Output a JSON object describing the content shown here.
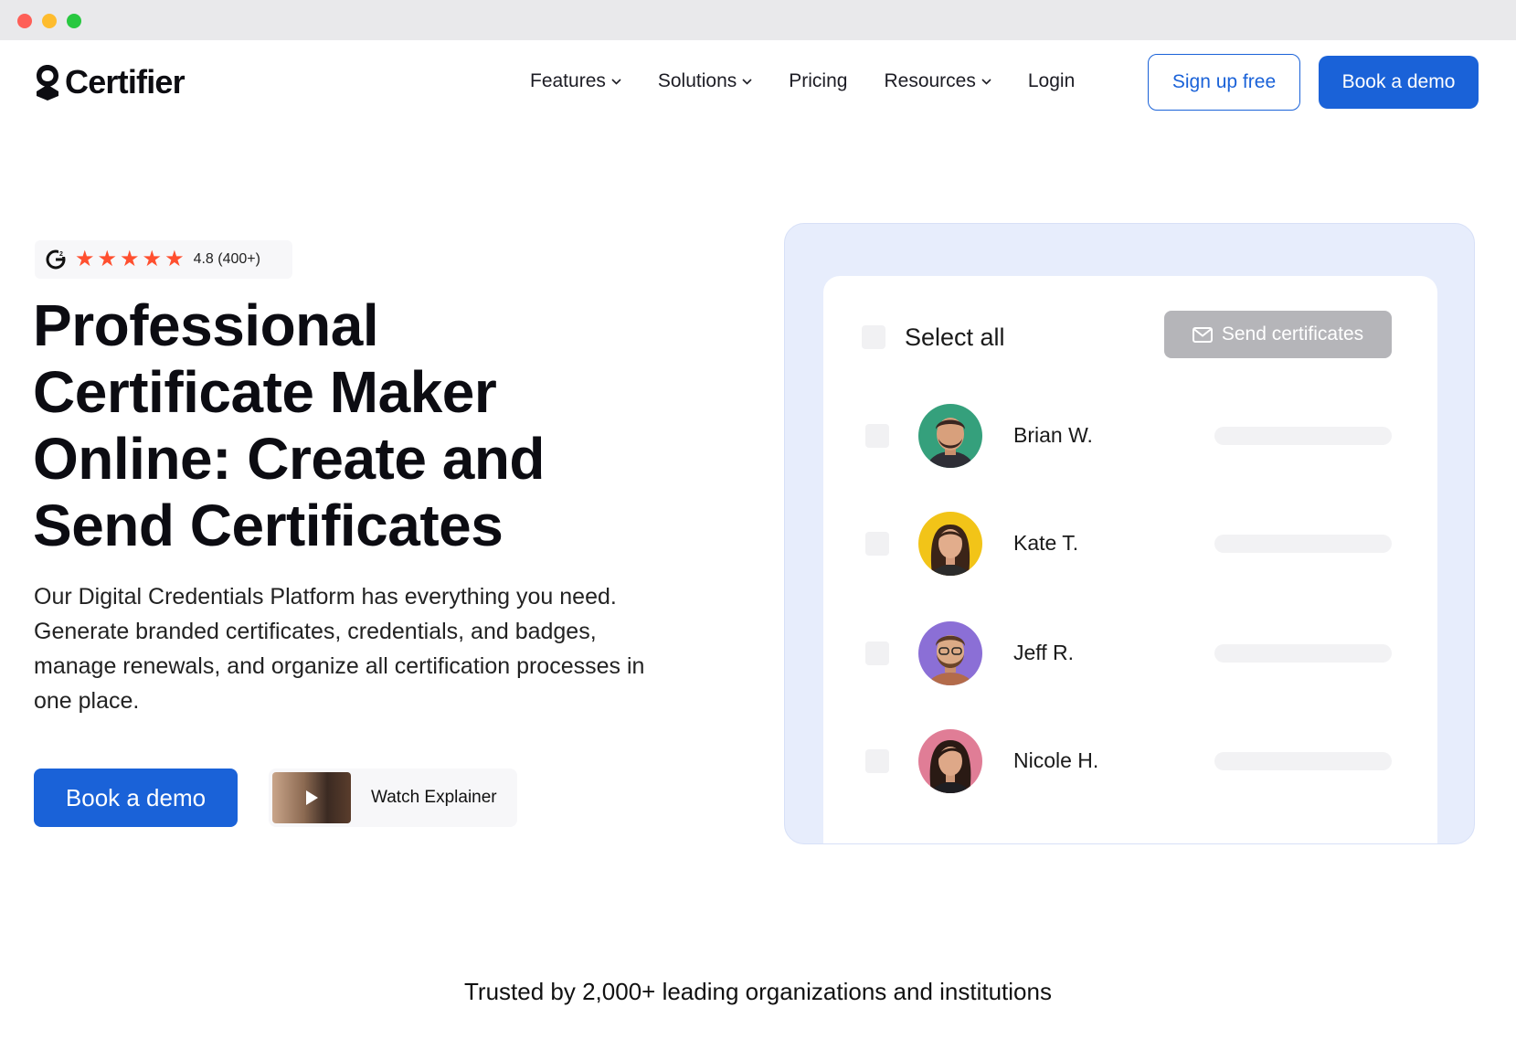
{
  "nav": {
    "brand": "Certifier",
    "items": [
      {
        "label": "Features",
        "dropdown": true
      },
      {
        "label": "Solutions",
        "dropdown": true
      },
      {
        "label": "Pricing",
        "dropdown": false
      },
      {
        "label": "Resources",
        "dropdown": true
      },
      {
        "label": "Login",
        "dropdown": false
      }
    ],
    "signup_label": "Sign up free",
    "demo_label": "Book a demo"
  },
  "rating": {
    "stars": 5,
    "text": "4.8 (400+)",
    "icon": "g2-icon",
    "star_color": "#ff4f2f"
  },
  "hero": {
    "title": "Professional Certificate Maker Online: Create and Send Certificates",
    "description": "Our Digital Credentials Platform has everything you need. Generate branded certificates, credentials, and badges, manage renewals, and organize all certification processes in one place.",
    "cta_label": "Book a demo",
    "watch_label": "Watch Explainer"
  },
  "panel": {
    "select_all_label": "Select all",
    "send_label": "Send certificates",
    "recipients": [
      {
        "name": "Brian W.",
        "avatar_bg": "#35a07c"
      },
      {
        "name": "Kate T.",
        "avatar_bg": "#f2c418"
      },
      {
        "name": "Jeff R.",
        "avatar_bg": "#8b6fd6"
      },
      {
        "name": "Nicole H.",
        "avatar_bg": "#e07d96"
      }
    ]
  },
  "footer": {
    "trusted_text": "Trusted by 2,000+ leading organizations and institutions"
  },
  "colors": {
    "accent": "#1a62d8",
    "panel_bg": "#e7edfc",
    "send_disabled": "#b5b5b9"
  }
}
